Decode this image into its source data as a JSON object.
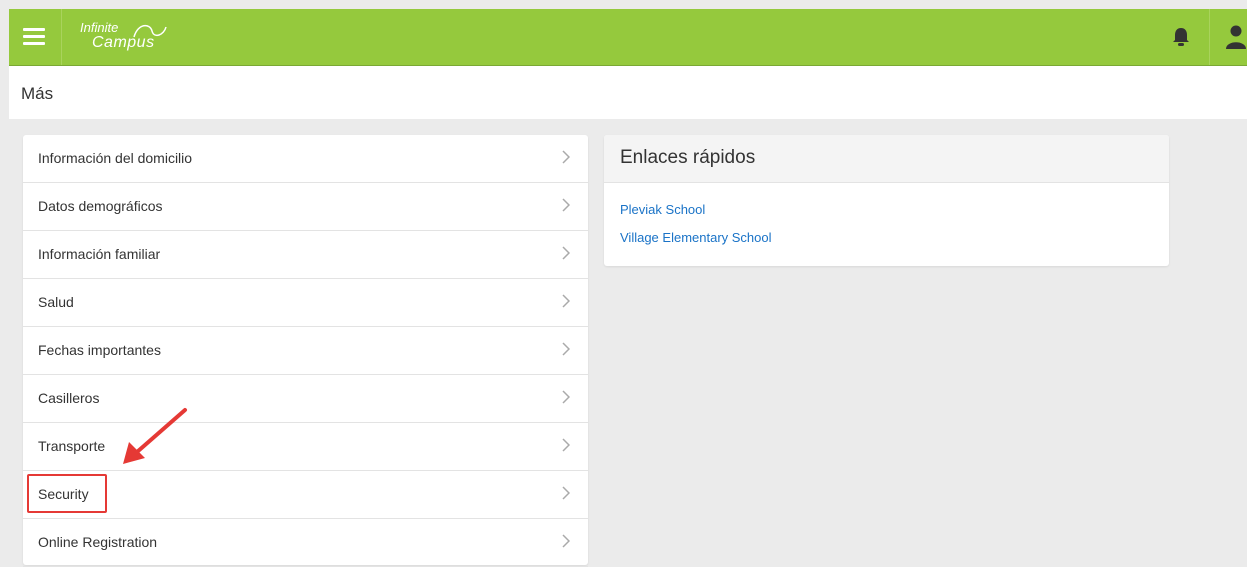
{
  "app": {
    "logo_line1": "Infinite",
    "logo_line2": "Campus"
  },
  "page": {
    "title": "Más"
  },
  "menu": {
    "items": [
      {
        "label": "Información del domicilio"
      },
      {
        "label": "Datos demográficos"
      },
      {
        "label": "Información familiar"
      },
      {
        "label": "Salud"
      },
      {
        "label": "Fechas importantes"
      },
      {
        "label": "Casilleros"
      },
      {
        "label": "Transporte"
      },
      {
        "label": "Security"
      },
      {
        "label": "Online Registration"
      }
    ]
  },
  "quick_links": {
    "title": "Enlaces rápidos",
    "links": [
      {
        "label": "Pleviak School"
      },
      {
        "label": "Village Elementary School"
      }
    ]
  },
  "icons": {
    "menu": "hamburger-menu-icon",
    "notifications": "bell-icon",
    "user": "user-icon",
    "chevron": "chevron-right-icon"
  },
  "colors": {
    "header_bg": "#95c93d",
    "link": "#1a73c7",
    "annotation": "#e53935"
  }
}
